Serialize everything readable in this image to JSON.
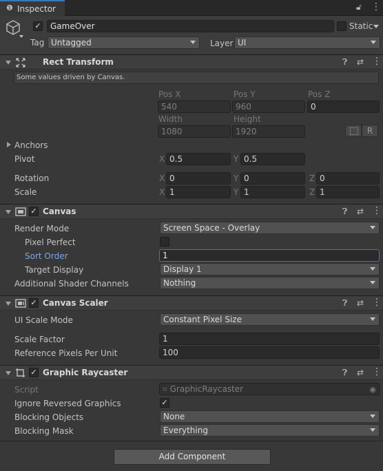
{
  "tab": {
    "icon": "info-icon",
    "label": "Inspector",
    "lock_icon": "lock-icon",
    "menu_icon": "kebab-menu-icon"
  },
  "gameobject": {
    "icon": "cube-icon",
    "active": true,
    "name": "GameOver",
    "static_label": "Static",
    "static_checked": false,
    "tag_label": "Tag",
    "tag_value": "Untagged",
    "layer_label": "Layer",
    "layer_value": "UI"
  },
  "rect_transform": {
    "title": "Rect Transform",
    "icon": "rect-transform-icon",
    "info": "Some values driven by Canvas.",
    "posx_label": "Pos X",
    "posy_label": "Pos Y",
    "posz_label": "Pos Z",
    "posx": "540",
    "posy": "960",
    "posz": "0",
    "width_label": "Width",
    "height_label": "Height",
    "width": "1080",
    "height": "1920",
    "raw_button": "R",
    "anchors_label": "Anchors",
    "pivot_label": "Pivot",
    "pivot_x": "0.5",
    "pivot_y": "0.5",
    "rotation_label": "Rotation",
    "rot_x": "0",
    "rot_y": "0",
    "rot_z": "0",
    "scale_label": "Scale",
    "scale_x": "1",
    "scale_y": "1",
    "scale_z": "1",
    "x_label": "X",
    "y_label": "Y",
    "z_label": "Z"
  },
  "canvas": {
    "title": "Canvas",
    "enabled": true,
    "render_mode_label": "Render Mode",
    "render_mode": "Screen Space - Overlay",
    "pixel_perfect_label": "Pixel Perfect",
    "pixel_perfect": false,
    "sort_order_label": "Sort Order",
    "sort_order": "1",
    "target_display_label": "Target Display",
    "target_display": "Display 1",
    "shader_channels_label": "Additional Shader Channels",
    "shader_channels": "Nothing"
  },
  "canvas_scaler": {
    "title": "Canvas Scaler",
    "enabled": true,
    "scale_mode_label": "UI Scale Mode",
    "scale_mode": "Constant Pixel Size",
    "scale_factor_label": "Scale Factor",
    "scale_factor": "1",
    "ref_ppu_label": "Reference Pixels Per Unit",
    "ref_ppu": "100"
  },
  "graphic_raycaster": {
    "title": "Graphic Raycaster",
    "enabled": true,
    "script_label": "Script",
    "script_value": "GraphicRaycaster",
    "ignore_reversed_label": "Ignore Reversed Graphics",
    "ignore_reversed": true,
    "blocking_objects_label": "Blocking Objects",
    "blocking_objects": "None",
    "blocking_mask_label": "Blocking Mask",
    "blocking_mask": "Everything"
  },
  "add_component_label": "Add Component",
  "colors": {
    "accent_blue": "#3a79bb",
    "highlight_label": "#7ba8e6",
    "panel_bg": "#383838",
    "field_bg": "#2a2a2a"
  }
}
